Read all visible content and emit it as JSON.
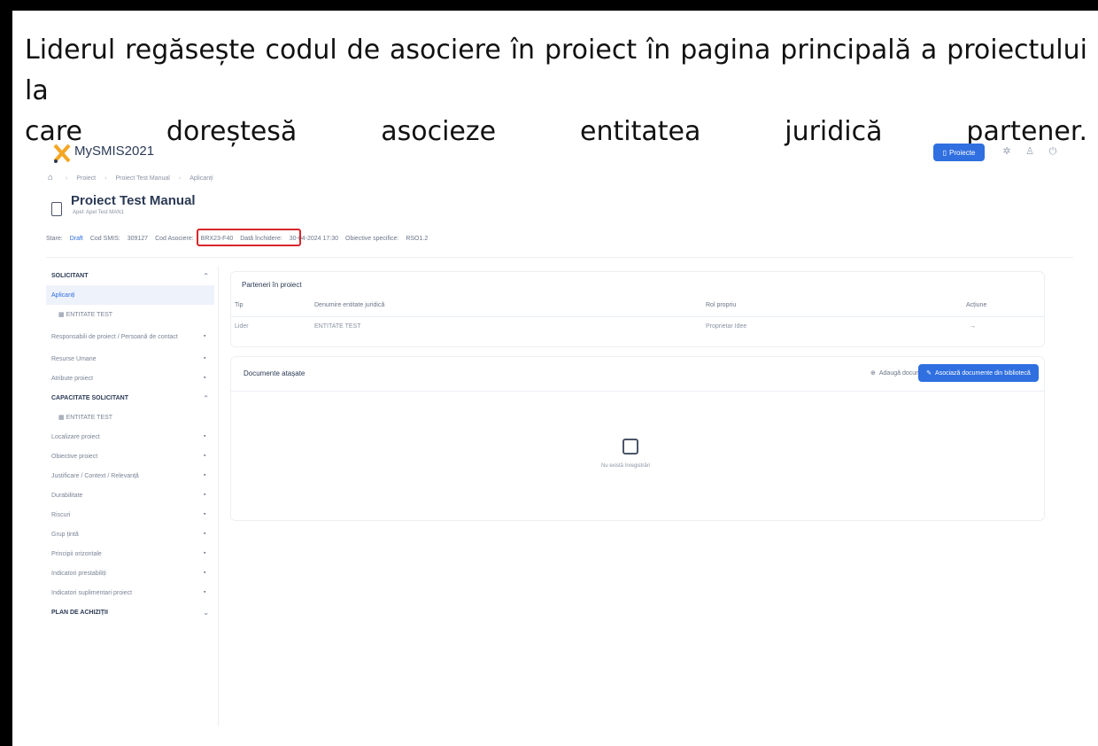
{
  "caption": {
    "line1": "Liderul regăsește codul de asociere în proiect în pagina principală a proiectului la",
    "line2": "care doreștesă asocieze entitatea juridică partener."
  },
  "header": {
    "brand": "MySMIS2021",
    "projects_button": "Proiecte",
    "icons": [
      "settings-icon",
      "user-icon",
      "power-icon"
    ]
  },
  "breadcrumb": [
    "Proiect",
    "Proiect Test Manual",
    "Aplicanți"
  ],
  "project": {
    "title": "Proiect Test Manual",
    "subtitle": "Apel: Apel Test MAN1",
    "status_label": "Stare:",
    "status_value": "Draft",
    "smis_label": "Cod SMIS:",
    "smis_value": "309127",
    "assoc_label": "Cod Asociere:",
    "assoc_value": "BRX23-F40",
    "closing_label": "Dată închidere:",
    "closing_value": "30-04-2024 17:30",
    "objective_label": "Obiective specifice:",
    "objective_value": "RSO1.2"
  },
  "sidebar": {
    "sections": [
      {
        "title": "SOLICITANT",
        "items": [
          {
            "label": "Aplicanți",
            "active": true,
            "sub": false
          },
          {
            "label": "ENTITATE TEST",
            "sub": true
          }
        ]
      },
      {
        "title": "",
        "items": [
          {
            "label": "Responsabili de proiect / Persoană de contact"
          },
          {
            "label": "Resurse Umane"
          },
          {
            "label": "Atribute proiect"
          }
        ]
      },
      {
        "title": "CAPACITATE SOLICITANT",
        "items": [
          {
            "label": "ENTITATE TEST",
            "sub": true
          },
          {
            "label": "Localizare proiect"
          },
          {
            "label": "Obiective proiect"
          },
          {
            "label": "Justificare / Context / Relevanță"
          },
          {
            "label": "Durabilitate"
          },
          {
            "label": "Riscuri"
          },
          {
            "label": "Grup țintă"
          },
          {
            "label": "Principii orizontale"
          },
          {
            "label": "Indicatori prestabiliți"
          },
          {
            "label": "Indicatori suplimentari proiect"
          }
        ]
      },
      {
        "title": "PLAN DE ACHIZIȚII",
        "items": []
      }
    ]
  },
  "partners_panel": {
    "title": "Parteneri în proiect",
    "columns": [
      "Tip",
      "Denumire entitate juridică",
      "Rol propriu",
      "Acțiune"
    ],
    "rows": [
      {
        "tip": "Lider",
        "denumire": "ENTITATE TEST",
        "rol": "Proprietar Idee",
        "actiune": "→"
      }
    ]
  },
  "documents_panel": {
    "title": "Documente atașate",
    "add_button": "Adaugă document nou",
    "associate_button": "Asociază documente din bibliotecă",
    "empty_text": "Nu există înregistrări"
  },
  "colors": {
    "accent": "#2f6fe0",
    "highlight": "#d7262e",
    "brand_logo": "#f5a623"
  }
}
